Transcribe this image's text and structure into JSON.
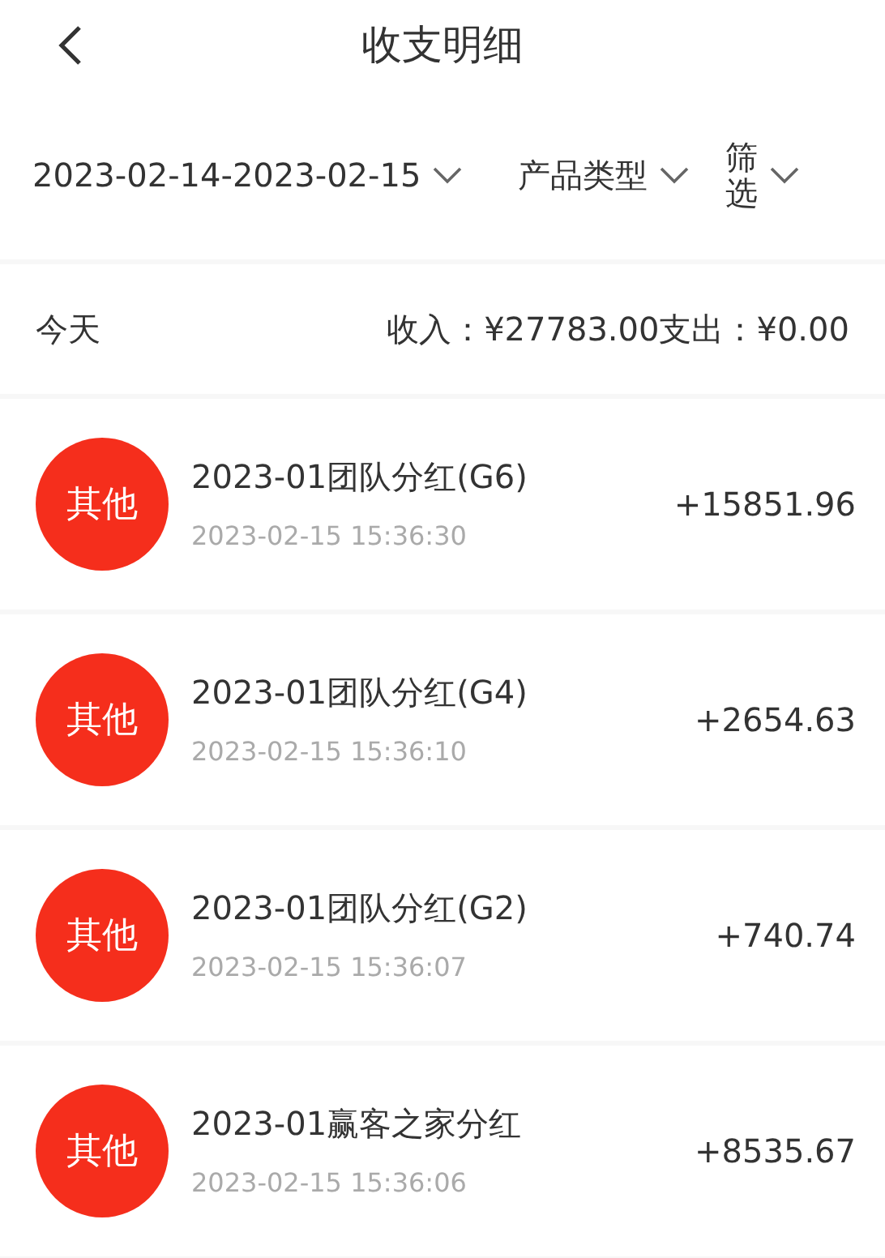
{
  "header": {
    "title": "收支明细"
  },
  "filters": [
    {
      "label": "2023-02-14-2023-02-15",
      "kind": "inline"
    },
    {
      "label": "产品类型",
      "kind": "inline"
    },
    {
      "label": "筛选",
      "kind": "stacked"
    }
  ],
  "summary": {
    "day": "今天",
    "income": "收入：¥27783.00",
    "expense": "支出：¥0.00"
  },
  "records": [
    {
      "badge": "其他",
      "title": "2023-01团队分红(G6)",
      "time": "2023-02-15 15:36:30",
      "amount": "+15851.96"
    },
    {
      "badge": "其他",
      "title": "2023-01团队分红(G4)",
      "time": "2023-02-15 15:36:10",
      "amount": "+2654.63"
    },
    {
      "badge": "其他",
      "title": "2023-01团队分红(G2)",
      "time": "2023-02-15 15:36:07",
      "amount": "+740.74"
    },
    {
      "badge": "其他",
      "title": "2023-01赢客之家分红",
      "time": "2023-02-15 15:36:06",
      "amount": "+8535.67"
    }
  ]
}
